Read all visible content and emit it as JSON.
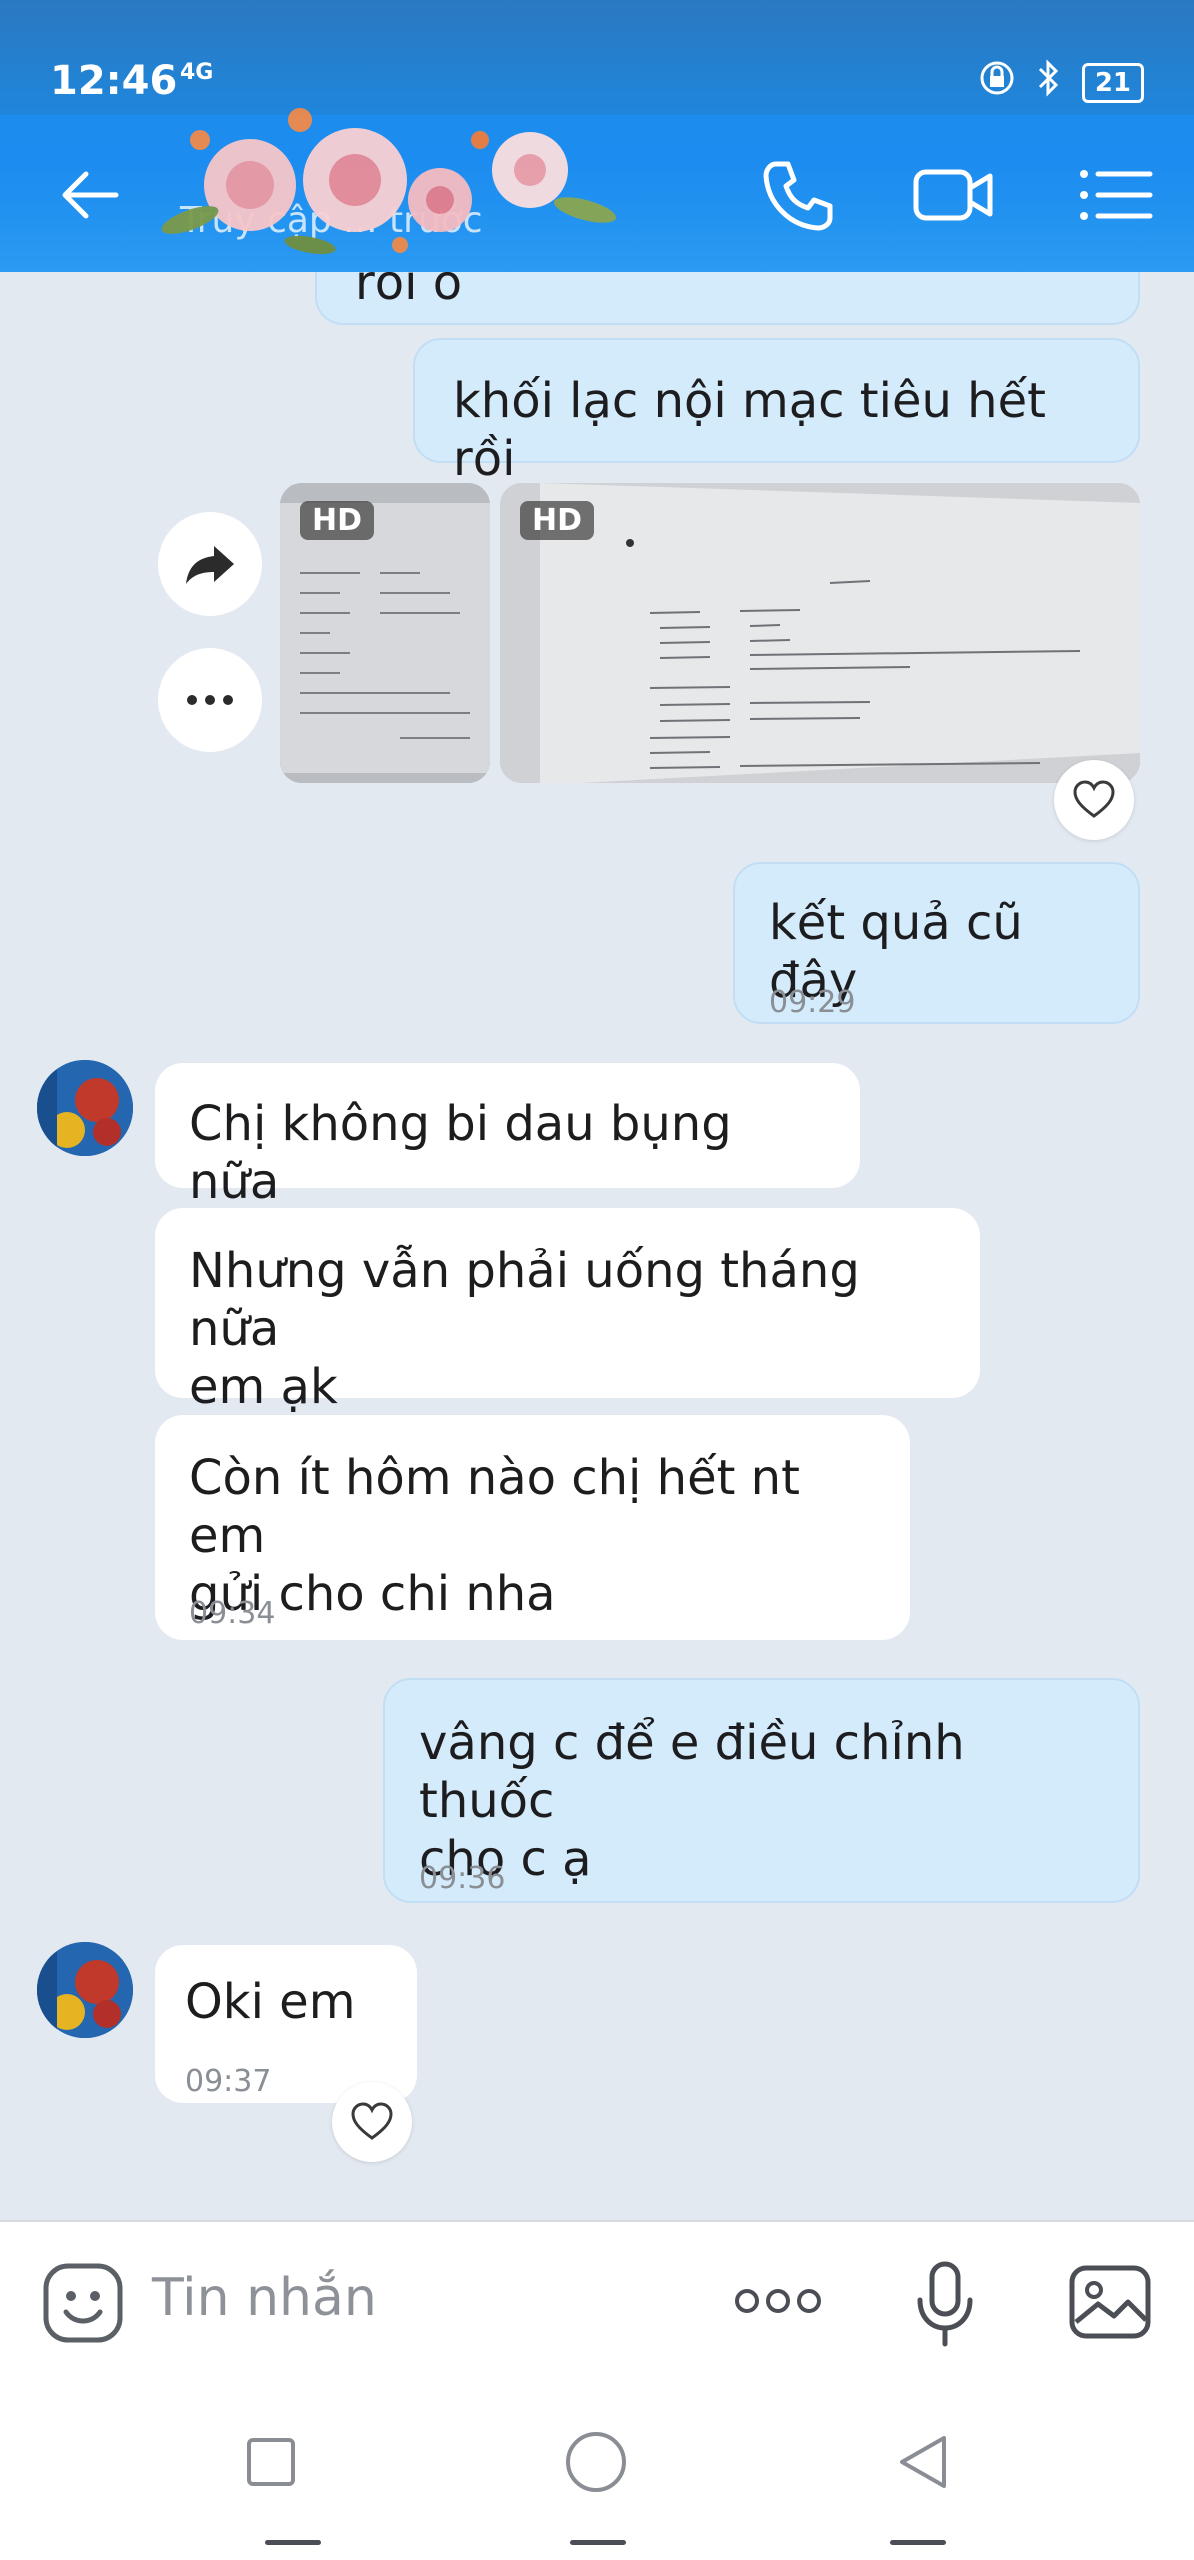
{
  "status_bar": {
    "time": "12:46",
    "network": "4G",
    "battery": "21"
  },
  "header": {
    "title": "Truy cập ... trước"
  },
  "messages": [
    {
      "id": "m0",
      "side": "out",
      "text": "ô thấy kết quả đã khỏi bệnh rồi ô"
    },
    {
      "id": "m1",
      "side": "out",
      "text": "khối lạc nội mạc tiêu hết rồi"
    },
    {
      "id": "m2",
      "side": "out",
      "type": "photos",
      "badges": [
        "HD",
        "HD"
      ]
    },
    {
      "id": "m3",
      "side": "out",
      "text": "kết quả cũ đây",
      "time": "09:29"
    },
    {
      "id": "m4",
      "side": "in",
      "text": "Chị không bi dau bụng nữa"
    },
    {
      "id": "m5",
      "side": "in",
      "text_lines": [
        "Nhưng vẫn phải uống tháng nữa",
        "em ạk"
      ]
    },
    {
      "id": "m6",
      "side": "in",
      "text_lines": [
        "Còn ít hôm nào chị hết nt em",
        "gửi cho chi nha"
      ],
      "time": "09:34"
    },
    {
      "id": "m7",
      "side": "out",
      "text_lines": [
        "vâng c để e điều chỉnh thuốc",
        "cho c ạ"
      ],
      "time": "09:36"
    },
    {
      "id": "m8",
      "side": "in",
      "text": "Oki em",
      "time": "09:37"
    }
  ],
  "composer": {
    "placeholder": "Tin nhắn"
  },
  "colors": {
    "header": "#1c8cf0",
    "out_bubble": "#d4ebfc",
    "in_bubble": "#ffffff",
    "background": "#e2e9f1"
  }
}
